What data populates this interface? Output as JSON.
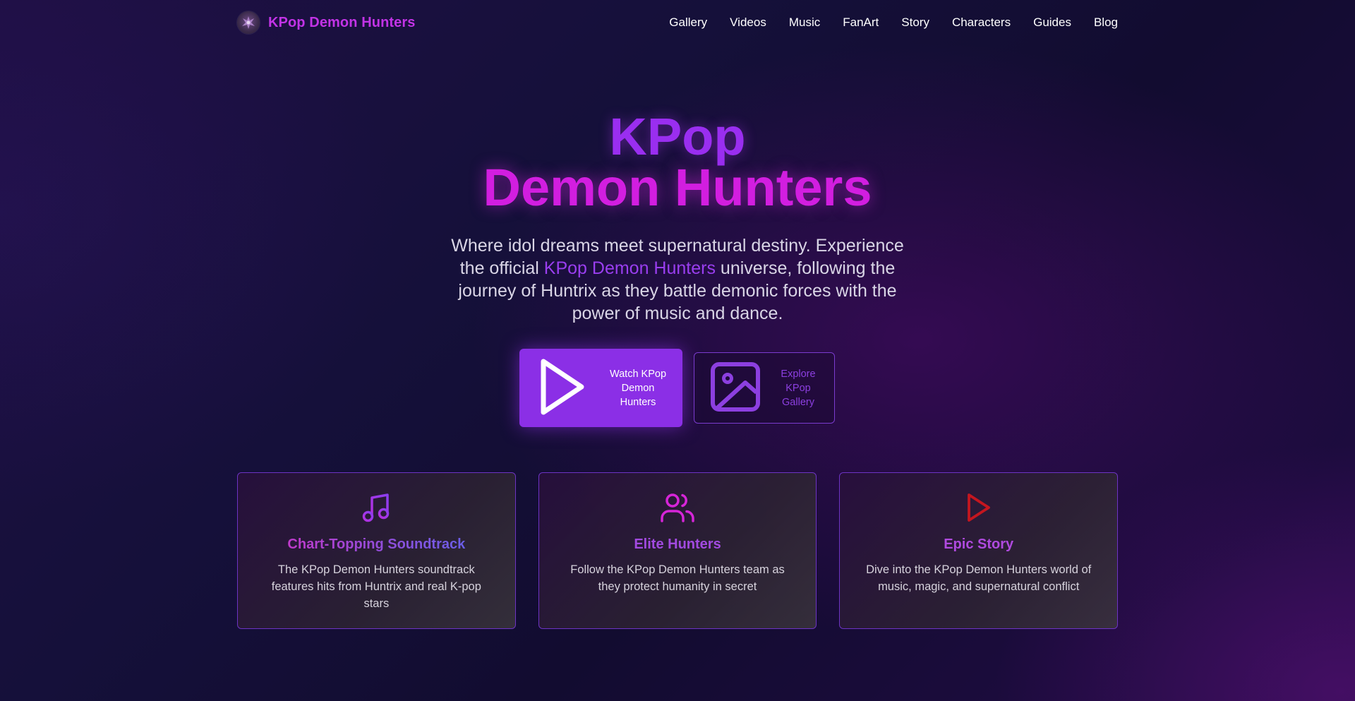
{
  "brand": {
    "name": "KPop Demon Hunters",
    "logo_icon": "demon-emblem-icon"
  },
  "nav": {
    "links": [
      "Gallery",
      "Videos",
      "Music",
      "FanArt",
      "Story",
      "Characters",
      "Guides",
      "Blog"
    ]
  },
  "hero": {
    "title_line1": "KPop",
    "title_line2": "Demon Hunters",
    "desc_before": "Where idol dreams meet supernatural destiny. Experience the official ",
    "desc_highlight": "KPop Demon Hunters",
    "desc_after": " universe, following the journey of Huntrix as they battle demonic forces with the power of music and dance."
  },
  "cta": {
    "primary_label": "Watch KPop Demon Hunters",
    "primary_icon": "play-icon",
    "secondary_label": "Explore KPop Gallery",
    "secondary_icon": "image-icon"
  },
  "features": [
    {
      "icon": "music-note-icon",
      "title": "Chart-Topping Soundtrack",
      "text": "The KPop Demon Hunters soundtrack features hits from Huntrix and real K-pop stars"
    },
    {
      "icon": "users-icon",
      "title": "Elite Hunters",
      "text": "Follow the KPop Demon Hunters team as they protect humanity in secret"
    },
    {
      "icon": "play-icon",
      "title": "Epic Story",
      "text": "Dive into the KPop Demon Hunters world of music, magic, and supernatural conflict"
    }
  ],
  "colors": {
    "accent_purple": "#8b2fe6",
    "accent_magenta": "#d21ee0",
    "brand_text": "#c233e6",
    "epic_story_icon": "#c4161f"
  }
}
